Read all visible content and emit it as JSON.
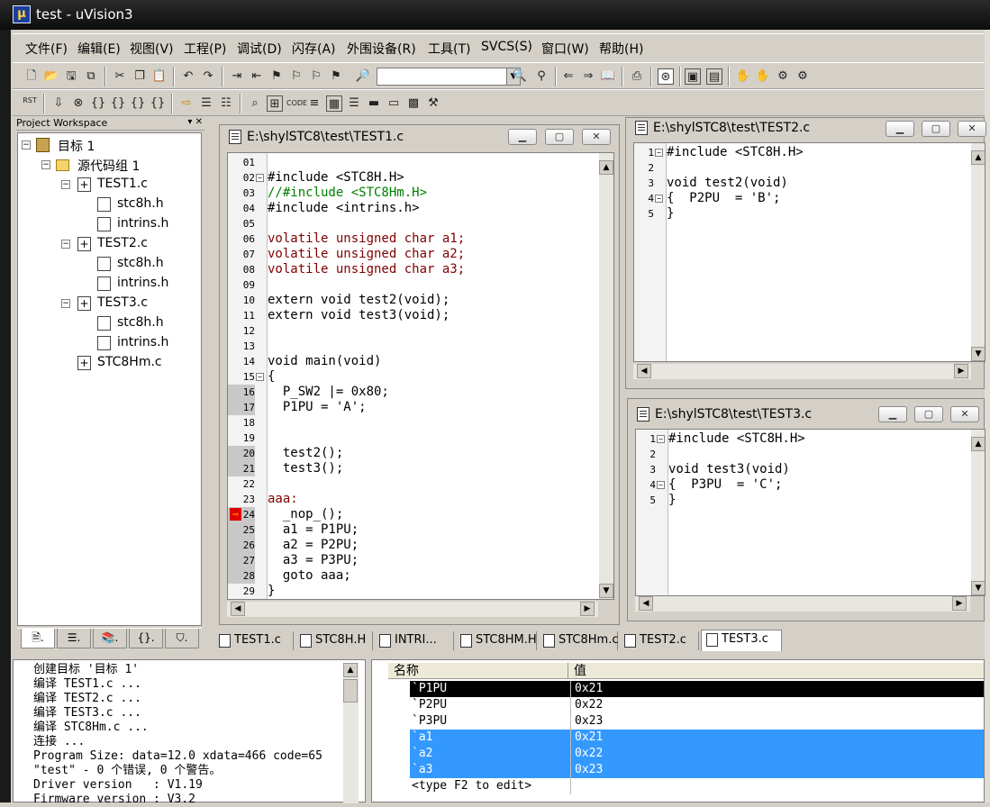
{
  "window": {
    "title": "test  - uVision3"
  },
  "menu": [
    "文件(F)",
    "编辑(E)",
    "视图(V)",
    "工程(P)",
    "调试(D)",
    "闪存(A)",
    "外围设备(R)",
    "工具(T)",
    "SVCS(S)",
    "窗口(W)",
    "帮助(H)"
  ],
  "toolbar": {
    "rst_label": "RST"
  },
  "workspace": {
    "title": "Project Workspace",
    "tree": [
      {
        "label": "目标 1",
        "level": 0,
        "type": "target"
      },
      {
        "label": "源代码组 1",
        "level": 1,
        "type": "folder"
      },
      {
        "label": "TEST1.c",
        "level": 2,
        "type": "file"
      },
      {
        "label": "stc8h.h",
        "level": 3,
        "type": "header"
      },
      {
        "label": "intrins.h",
        "level": 3,
        "type": "header"
      },
      {
        "label": "TEST2.c",
        "level": 2,
        "type": "file"
      },
      {
        "label": "stc8h.h",
        "level": 3,
        "type": "header"
      },
      {
        "label": "intrins.h",
        "level": 3,
        "type": "header"
      },
      {
        "label": "TEST3.c",
        "level": 2,
        "type": "file"
      },
      {
        "label": "stc8h.h",
        "level": 3,
        "type": "header"
      },
      {
        "label": "intrins.h",
        "level": 3,
        "type": "header"
      },
      {
        "label": "STC8Hm.c",
        "level": 2,
        "type": "file"
      }
    ]
  },
  "editors": {
    "test1": {
      "title": "E:\\shylSTC8\\test\\TEST1.c"
    },
    "test2": {
      "title": "E:\\shylSTC8\\test\\TEST2.c"
    },
    "test3": {
      "title": "E:\\shylSTC8\\test\\TEST3.c"
    }
  },
  "test1_lines": [
    {
      "n": "01",
      "t": ""
    },
    {
      "n": "02",
      "t": "#include <STC8H.H>",
      "c": "kw"
    },
    {
      "n": "03",
      "t": "//#include <STC8Hm.H>",
      "c": "cm"
    },
    {
      "n": "04",
      "t": "#include <intrins.h>",
      "c": "kw"
    },
    {
      "n": "05",
      "t": ""
    },
    {
      "n": "06",
      "t": "volatile unsigned char a1;",
      "c": "lab"
    },
    {
      "n": "07",
      "t": "volatile unsigned char a2;",
      "c": "lab"
    },
    {
      "n": "08",
      "t": "volatile unsigned char a3;",
      "c": "lab"
    },
    {
      "n": "09",
      "t": ""
    },
    {
      "n": "10",
      "t": "extern void test2(void);"
    },
    {
      "n": "11",
      "t": "extern void test3(void);"
    },
    {
      "n": "12",
      "t": ""
    },
    {
      "n": "13",
      "t": ""
    },
    {
      "n": "14",
      "t": "void main(void)"
    },
    {
      "n": "15",
      "t": "{"
    },
    {
      "n": "16",
      "t": "  P_SW2 |= 0x80;"
    },
    {
      "n": "17",
      "t": "  P1PU = 'A';"
    },
    {
      "n": "18",
      "t": ""
    },
    {
      "n": "19",
      "t": ""
    },
    {
      "n": "20",
      "t": "  test2();"
    },
    {
      "n": "21",
      "t": "  test3();"
    },
    {
      "n": "22",
      "t": ""
    },
    {
      "n": "23",
      "t": "aaa:",
      "c": "lab"
    },
    {
      "n": "24",
      "t": "  _nop_();"
    },
    {
      "n": "25",
      "t": "  a1 = P1PU;"
    },
    {
      "n": "26",
      "t": "  a2 = P2PU;"
    },
    {
      "n": "27",
      "t": "  a3 = P3PU;"
    },
    {
      "n": "28",
      "t": "  goto aaa;"
    },
    {
      "n": "29",
      "t": "}"
    }
  ],
  "test2_lines": [
    {
      "n": "1",
      "t": "#include <STC8H.H>"
    },
    {
      "n": "2",
      "t": ""
    },
    {
      "n": "3",
      "t": "void test2(void)"
    },
    {
      "n": "4",
      "t": "{  P2PU  = 'B';"
    },
    {
      "n": "5",
      "t": "}"
    }
  ],
  "test3_lines": [
    {
      "n": "1",
      "t": "#include <STC8H.H>"
    },
    {
      "n": "2",
      "t": ""
    },
    {
      "n": "3",
      "t": "void test3(void)"
    },
    {
      "n": "4",
      "t": "{  P3PU  = 'C';"
    },
    {
      "n": "5",
      "t": "}"
    }
  ],
  "file_tabs": [
    "TEST1.c",
    "STC8H.H",
    "INTRI...",
    "STC8HM.H",
    "STC8Hm.c",
    "TEST2.c",
    "TEST3.c"
  ],
  "output_lines": [
    "创建目标 '目标 1'",
    "编译 TEST1.c ...",
    "编译 TEST2.c ...",
    "编译 TEST3.c ...",
    "编译 STC8Hm.c ...",
    "连接 ...",
    "Program Size: data=12.0 xdata=466 code=65",
    "\"test\" - 0 个错误, 0 个警告。",
    "Driver version   : V1.19",
    "Firmware version : V3.2"
  ],
  "watch": {
    "col_name": "名称",
    "col_value": "值",
    "rows": [
      {
        "name": "`P1PU",
        "value": "0x21",
        "sel": "dark"
      },
      {
        "name": "`P2PU",
        "value": "0x22",
        "sel": ""
      },
      {
        "name": "`P3PU",
        "value": "0x23",
        "sel": ""
      },
      {
        "name": "`a1",
        "value": "0x21",
        "sel": "blue"
      },
      {
        "name": "`a2",
        "value": "0x22",
        "sel": "blue"
      },
      {
        "name": "`a3",
        "value": "0x23",
        "sel": "blue"
      },
      {
        "name": "<type F2 to edit>",
        "value": "",
        "sel": ""
      }
    ]
  }
}
